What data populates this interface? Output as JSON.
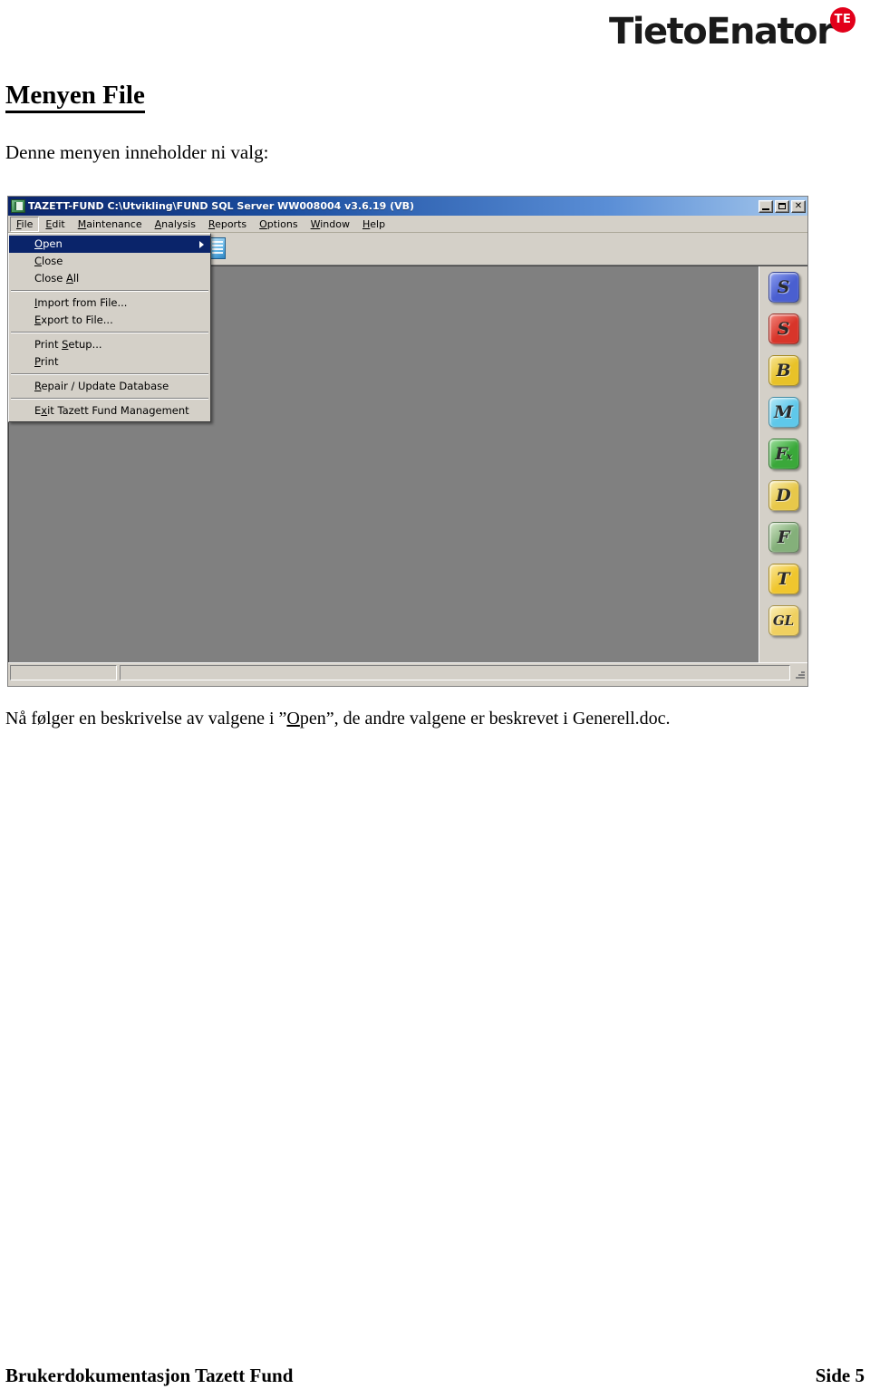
{
  "logo": {
    "wordmark": "TietoEnator",
    "badge": "TE",
    "badge_color": "#e2001a"
  },
  "document": {
    "title": "Menyen File",
    "intro": "Denne menyen inneholder ni valg:",
    "body_prefix": "Nå følger en beskrivelse av valgene i ”",
    "body_underlined": "O",
    "body_mid": "pen”, de andre valgene er beskrevet i Generell.doc.",
    "footer_left": "Brukerdokumentasjon Tazett Fund",
    "footer_right": "Side 5"
  },
  "window": {
    "title": "TAZETT-FUND  C:\\Utvikling\\FUND  SQL Server WW008004  v3.6.19 (VB)",
    "caption_buttons": {
      "minimize": "minimize-icon",
      "maximize": "maximize-icon",
      "close": "✕"
    },
    "menubar": [
      {
        "label": "File",
        "mnemonic": "F",
        "rest": "ile",
        "open": true
      },
      {
        "label": "Edit",
        "mnemonic": "E",
        "rest": "dit",
        "open": false
      },
      {
        "label": "Maintenance",
        "mnemonic": "M",
        "rest": "aintenance",
        "open": false
      },
      {
        "label": "Analysis",
        "mnemonic": "A",
        "rest": "nalysis",
        "open": false
      },
      {
        "label": "Reports",
        "mnemonic": "R",
        "rest": "eports",
        "open": false
      },
      {
        "label": "Options",
        "mnemonic": "O",
        "rest": "ptions",
        "open": false
      },
      {
        "label": "Window",
        "mnemonic": "W",
        "rest": "indow",
        "open": false
      },
      {
        "label": "Help",
        "mnemonic": "H",
        "rest": "elp",
        "open": false
      }
    ],
    "toolbar": {
      "icons": [
        "open-document-icon"
      ]
    },
    "statusbar": {
      "panel_1": "",
      "panel_2": ""
    },
    "icon_bar": [
      {
        "label": "S",
        "name": "fund-icon-s-blue",
        "color": "#4a5fd0",
        "color2": "#8d9ff0"
      },
      {
        "label": "S",
        "name": "fund-icon-s-red",
        "color": "#d8352a",
        "color2": "#f2867c"
      },
      {
        "label": "B",
        "name": "fund-icon-b-gold",
        "color": "#e8c228",
        "color2": "#f7e596"
      },
      {
        "label": "M",
        "name": "fund-icon-m-cyan",
        "color": "#5fc8ea",
        "color2": "#b5e9f8"
      },
      {
        "label": "Fx",
        "name": "fund-icon-fx-green",
        "color": "#3aa83a",
        "color2": "#9de09d"
      },
      {
        "label": "D",
        "name": "fund-icon-d-gold",
        "color": "#e8c84a",
        "color2": "#f8ecae"
      },
      {
        "label": "F",
        "name": "fund-icon-f-sage",
        "color": "#84b07a",
        "color2": "#cfe3c4"
      },
      {
        "label": "T",
        "name": "fund-icon-t-gold",
        "color": "#f0c62e",
        "color2": "#fae79b"
      },
      {
        "label": "GL",
        "name": "fund-icon-gl-gold",
        "color": "#f0d060",
        "color2": "#fbf0bb"
      }
    ]
  },
  "file_menu": [
    {
      "type": "item",
      "label": "Open",
      "mnemonic": "O",
      "pre": "",
      "rest": "pen",
      "selected": true,
      "submenu": true
    },
    {
      "type": "item",
      "label": "Close",
      "mnemonic": "C",
      "pre": "",
      "rest": "lose",
      "selected": false,
      "submenu": false
    },
    {
      "type": "item",
      "label": "Close All",
      "mnemonic": "A",
      "pre": "Close ",
      "rest": "ll",
      "selected": false,
      "submenu": false
    },
    {
      "type": "separator"
    },
    {
      "type": "item",
      "label": "Import from File...",
      "mnemonic": "I",
      "pre": "",
      "rest": "mport from File...",
      "selected": false,
      "submenu": false
    },
    {
      "type": "item",
      "label": "Export to File...",
      "mnemonic": "E",
      "pre": "",
      "rest": "xport to File...",
      "selected": false,
      "submenu": false
    },
    {
      "type": "separator"
    },
    {
      "type": "item",
      "label": "Print Setup...",
      "mnemonic": "S",
      "pre": "Print ",
      "rest": "etup...",
      "selected": false,
      "submenu": false
    },
    {
      "type": "item",
      "label": "Print",
      "mnemonic": "P",
      "pre": "",
      "rest": "rint",
      "selected": false,
      "submenu": false
    },
    {
      "type": "separator"
    },
    {
      "type": "item",
      "label": "Repair / Update Database",
      "mnemonic": "R",
      "pre": "",
      "rest": "epair / Update Database",
      "selected": false,
      "submenu": false
    },
    {
      "type": "separator"
    },
    {
      "type": "item",
      "label": "Exit Tazett Fund Management",
      "mnemonic": "x",
      "pre": "E",
      "rest": "it Tazett Fund Management",
      "selected": false,
      "submenu": false
    }
  ]
}
